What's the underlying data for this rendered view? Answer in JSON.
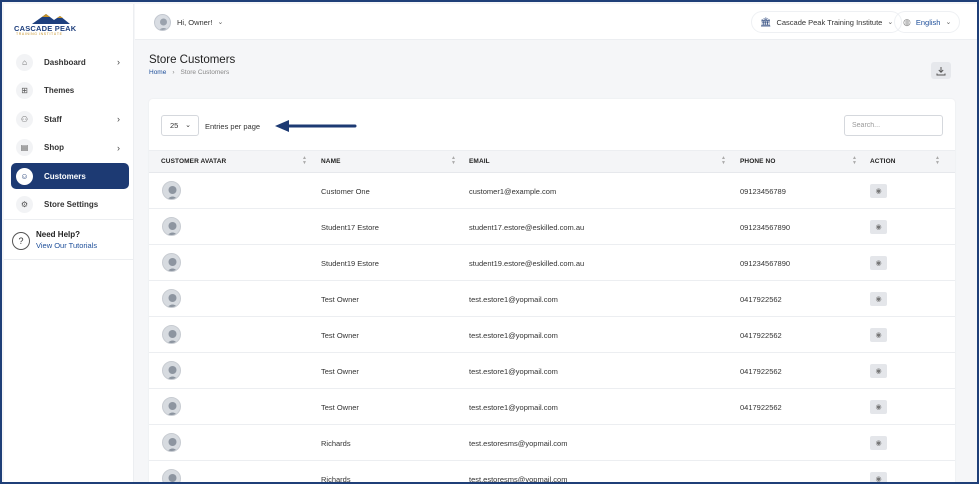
{
  "brand": {
    "name": "CASCADE PEAK",
    "tagline": "TRAINING INSTITUTE"
  },
  "topbar": {
    "greeting": "Hi, Owner!",
    "institute": "Cascade Peak Training Institute",
    "language": "English"
  },
  "sidebar": {
    "items": [
      {
        "label": "Dashboard",
        "icon": "home-icon",
        "chevron": true,
        "active": false
      },
      {
        "label": "Themes",
        "icon": "grid-icon",
        "chevron": false,
        "active": false
      },
      {
        "label": "Staff",
        "icon": "users-icon",
        "chevron": true,
        "active": false
      },
      {
        "label": "Shop",
        "icon": "shop-icon",
        "chevron": true,
        "active": false
      },
      {
        "label": "Customers",
        "icon": "user-icon",
        "chevron": false,
        "active": true
      },
      {
        "label": "Store Settings",
        "icon": "gear-icon",
        "chevron": false,
        "active": false
      }
    ],
    "help_title": "Need Help?",
    "help_link": "View Our Tutorials"
  },
  "page": {
    "title": "Store Customers",
    "breadcrumb_home": "Home",
    "breadcrumb_current": "Store Customers"
  },
  "table": {
    "entries_value": "25",
    "entries_label": "Entries per page",
    "search_placeholder": "Search...",
    "columns": [
      "CUSTOMER AVATAR",
      "NAME",
      "EMAIL",
      "PHONE NO",
      "ACTION"
    ],
    "rows": [
      {
        "name": "Customer One",
        "email": "customer1@example.com",
        "phone": "09123456789"
      },
      {
        "name": "Student17 Estore",
        "email": "student17.estore@eskilled.com.au",
        "phone": "091234567890"
      },
      {
        "name": "Student19 Estore",
        "email": "student19.estore@eskilled.com.au",
        "phone": "091234567890"
      },
      {
        "name": "Test Owner",
        "email": "test.estore1@yopmail.com",
        "phone": "0417922562"
      },
      {
        "name": "Test Owner",
        "email": "test.estore1@yopmail.com",
        "phone": "0417922562"
      },
      {
        "name": "Test Owner",
        "email": "test.estore1@yopmail.com",
        "phone": "0417922562"
      },
      {
        "name": "Test Owner",
        "email": "test.estore1@yopmail.com",
        "phone": "0417922562"
      },
      {
        "name": "Richards",
        "email": "test.estoresms@yopmail.com",
        "phone": ""
      },
      {
        "name": "Richards",
        "email": "test.estoresms@yopmail.com",
        "phone": ""
      }
    ]
  },
  "colors": {
    "primary": "#1d3a73",
    "link": "#1e4f9a",
    "accent_gold": "#c6932a"
  }
}
